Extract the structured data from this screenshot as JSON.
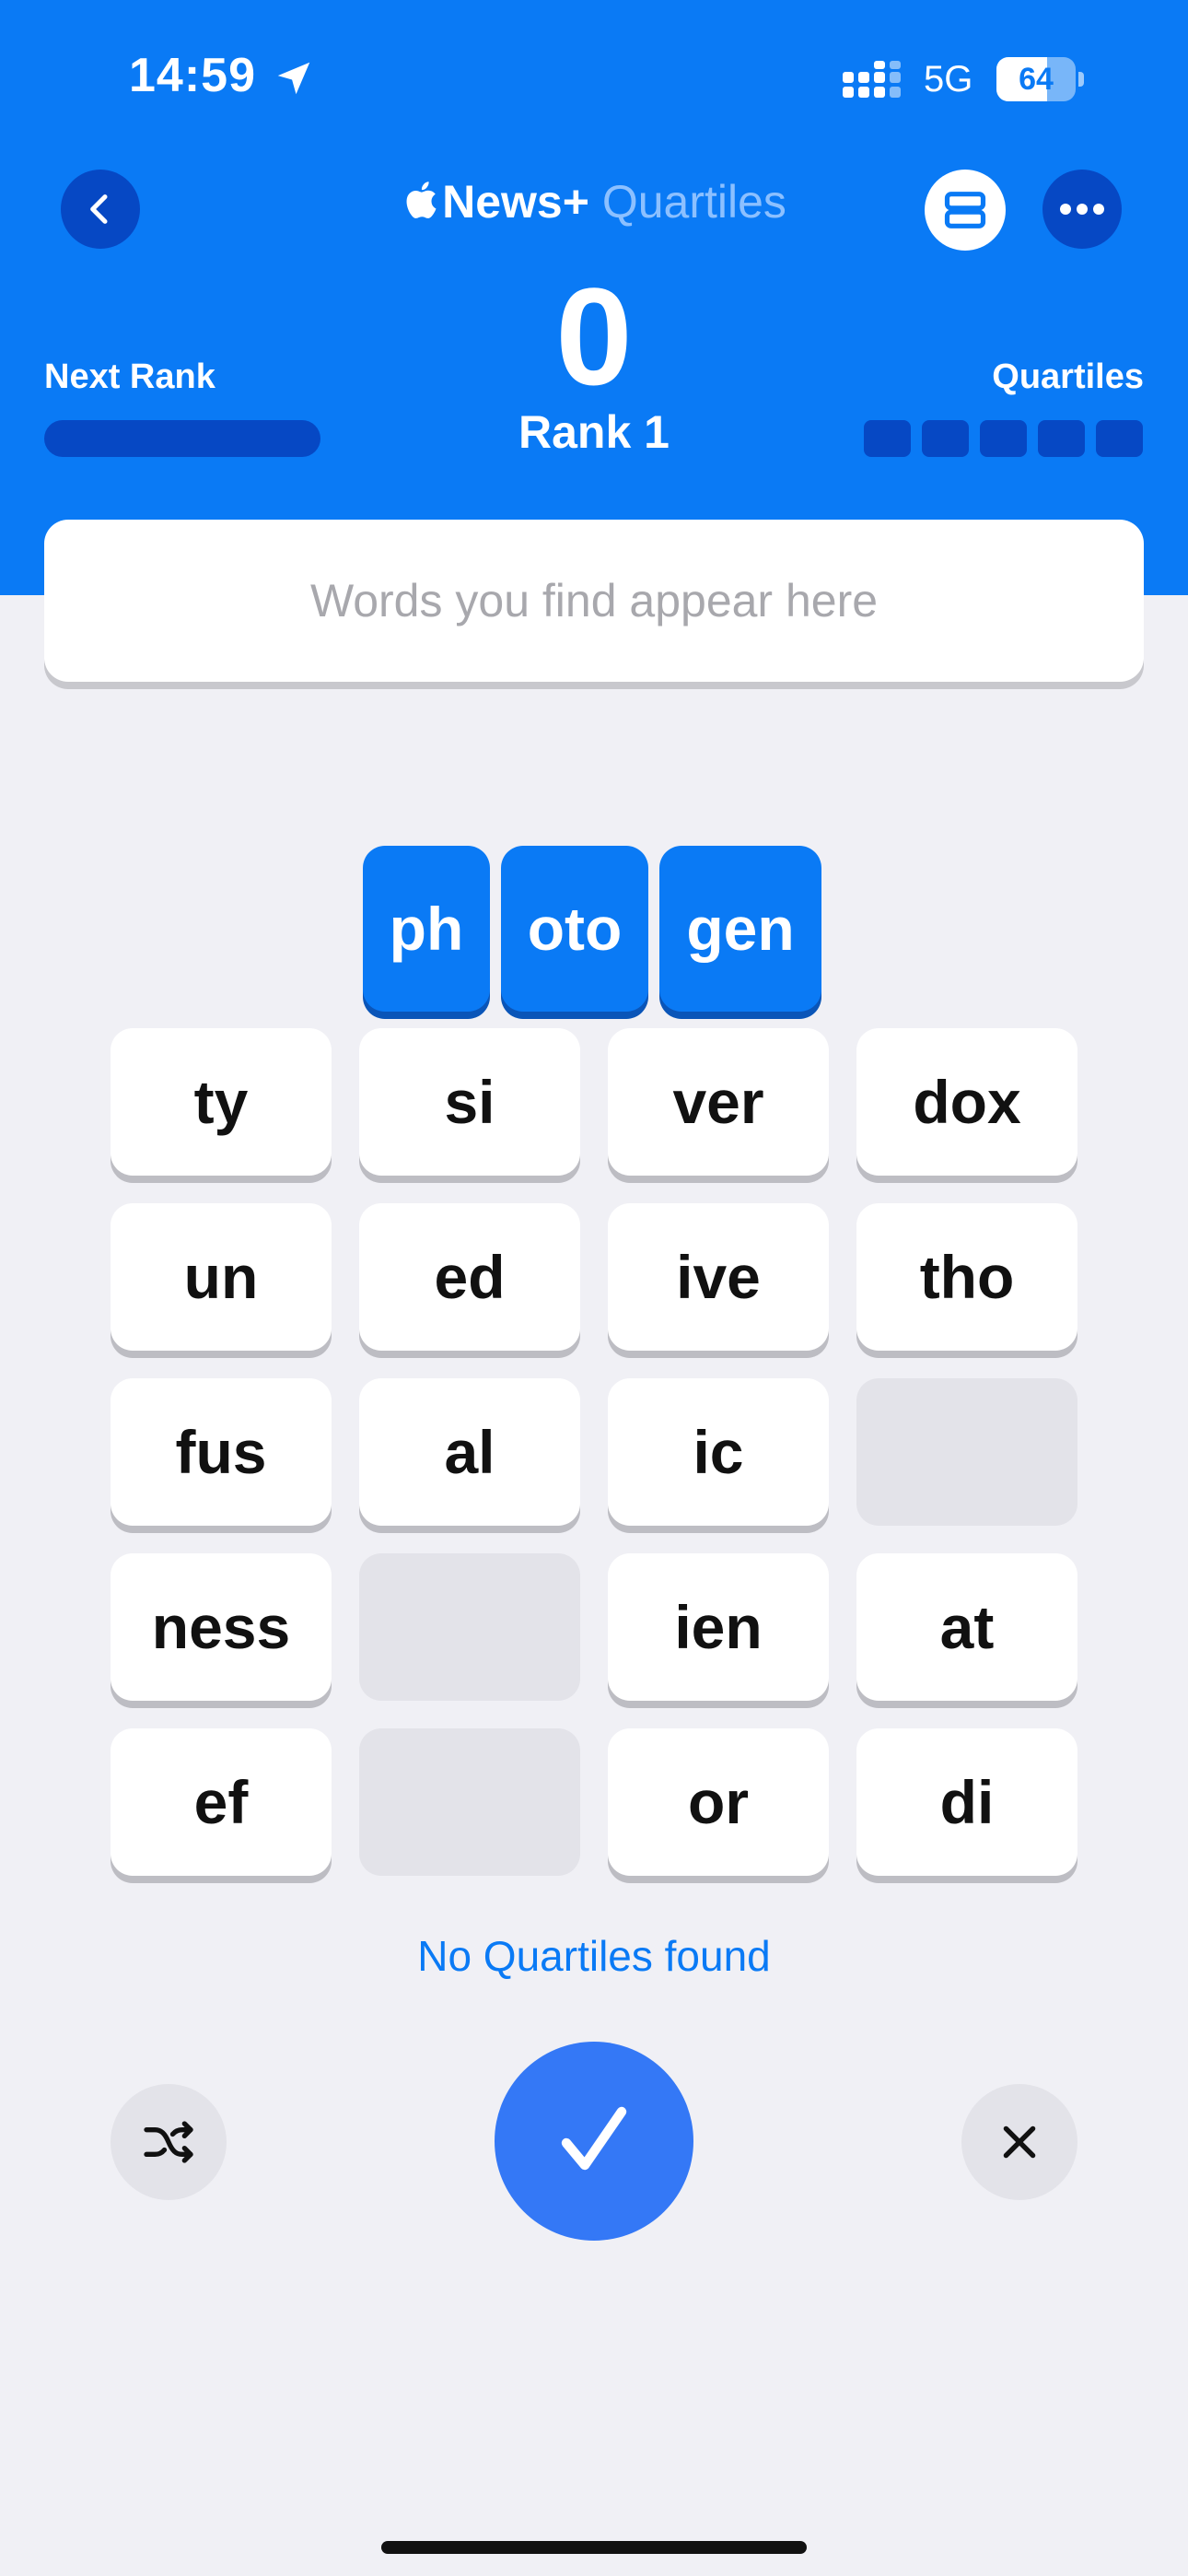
{
  "status_bar": {
    "time": "14:59",
    "network": "5G",
    "battery": "64",
    "battery_level": 0.64
  },
  "header": {
    "app_brand": "News+",
    "game_name": "Quartiles",
    "score": "0",
    "rank": "Rank 1",
    "next_rank_label": "Next Rank",
    "next_rank_progress": 0.0,
    "quartiles_label": "Quartiles",
    "quartiles_found": 0,
    "quartiles_total": 5
  },
  "words_box": {
    "placeholder": "Words you find appear here"
  },
  "selected_tiles": [
    "ph",
    "oto",
    "gen"
  ],
  "grid": [
    "ty",
    "si",
    "ver",
    "dox",
    "un",
    "ed",
    "ive",
    "tho",
    "fus",
    "al",
    "ic",
    "",
    "ness",
    "",
    "ien",
    "at",
    "ef",
    "",
    "or",
    "di"
  ],
  "status_message": "No Quartiles found",
  "colors": {
    "accent": "#0a7af5",
    "accent_dark": "#0648c4",
    "submit": "#3478f6",
    "background": "#f0f0f5"
  },
  "icons": [
    "location-arrow-icon",
    "signal-icon",
    "battery-icon",
    "chevron-left-icon",
    "archive-icon",
    "ellipsis-icon",
    "apple-logo-icon",
    "shuffle-icon",
    "checkmark-icon",
    "close-icon"
  ]
}
